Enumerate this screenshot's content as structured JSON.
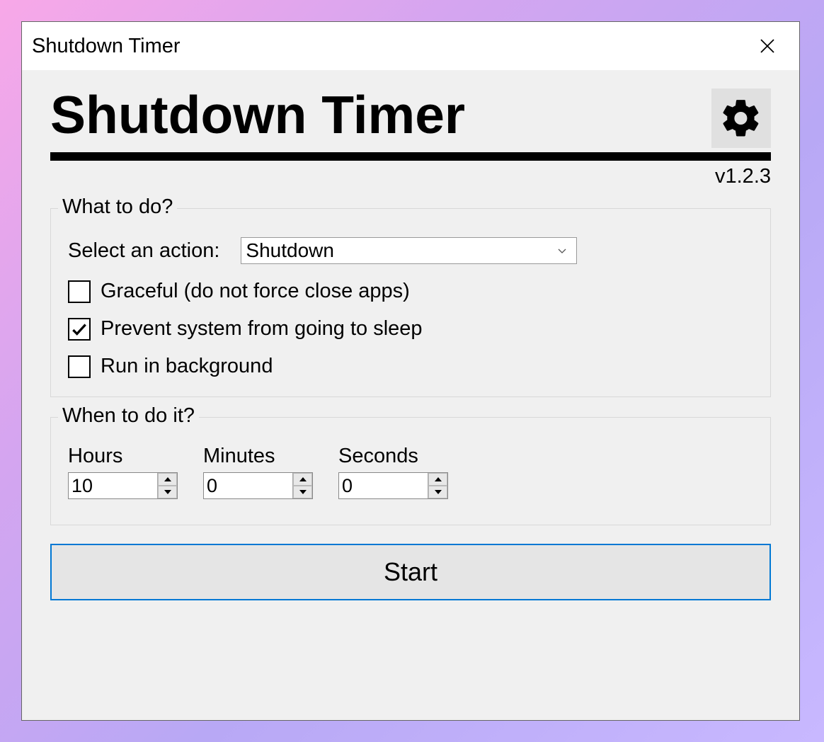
{
  "window": {
    "title": "Shutdown Timer"
  },
  "header": {
    "app_title": "Shutdown Timer",
    "version": "v1.2.3"
  },
  "what_section": {
    "legend": "What to do?",
    "select_label": "Select an action:",
    "select_value": "Shutdown",
    "checks": {
      "graceful": {
        "label": "Graceful (do not force close apps)",
        "checked": false
      },
      "prevent_sleep": {
        "label": "Prevent system from going to sleep",
        "checked": true
      },
      "background": {
        "label": "Run in background",
        "checked": false
      }
    }
  },
  "when_section": {
    "legend": "When to do it?",
    "hours_label": "Hours",
    "hours_value": "10",
    "minutes_label": "Minutes",
    "minutes_value": "0",
    "seconds_label": "Seconds",
    "seconds_value": "0"
  },
  "start_label": "Start"
}
